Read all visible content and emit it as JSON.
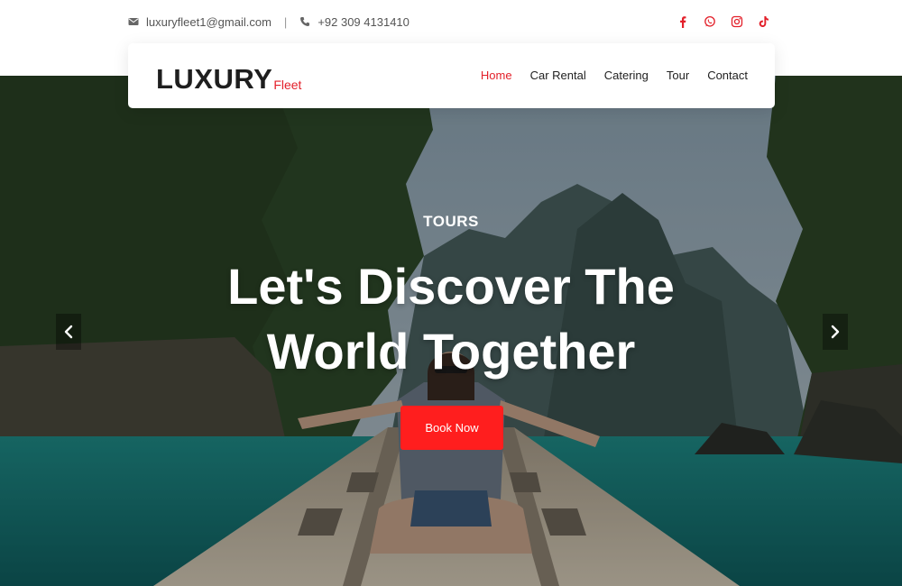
{
  "topbar": {
    "email": "luxuryfleet1@gmail.com",
    "separator": "|",
    "phone": "+92 309 4131410",
    "email_icon": "envelope-icon",
    "phone_icon": "phone-icon",
    "socials": [
      {
        "name": "facebook-icon",
        "color": "#e3202a"
      },
      {
        "name": "whatsapp-icon",
        "color": "#e3202a"
      },
      {
        "name": "instagram-icon",
        "color": "#e3202a"
      },
      {
        "name": "tiktok-icon",
        "color": "#e3202a"
      }
    ]
  },
  "brand": {
    "main": "LUXURY",
    "sub": "Fleet",
    "accent_color": "#e3202a"
  },
  "nav": {
    "items": [
      {
        "label": "Home",
        "active": true
      },
      {
        "label": "Car Rental",
        "active": false
      },
      {
        "label": "Catering",
        "active": false
      },
      {
        "label": "Tour",
        "active": false
      },
      {
        "label": "Contact",
        "active": false
      }
    ]
  },
  "hero": {
    "subtitle": "TOURS",
    "title_line1": "Let's Discover The",
    "title_line2": "World Together",
    "button_label": "Book Now",
    "button_color": "#ff1e1e",
    "prev_icon": "chevron-left-icon",
    "next_icon": "chevron-right-icon"
  }
}
